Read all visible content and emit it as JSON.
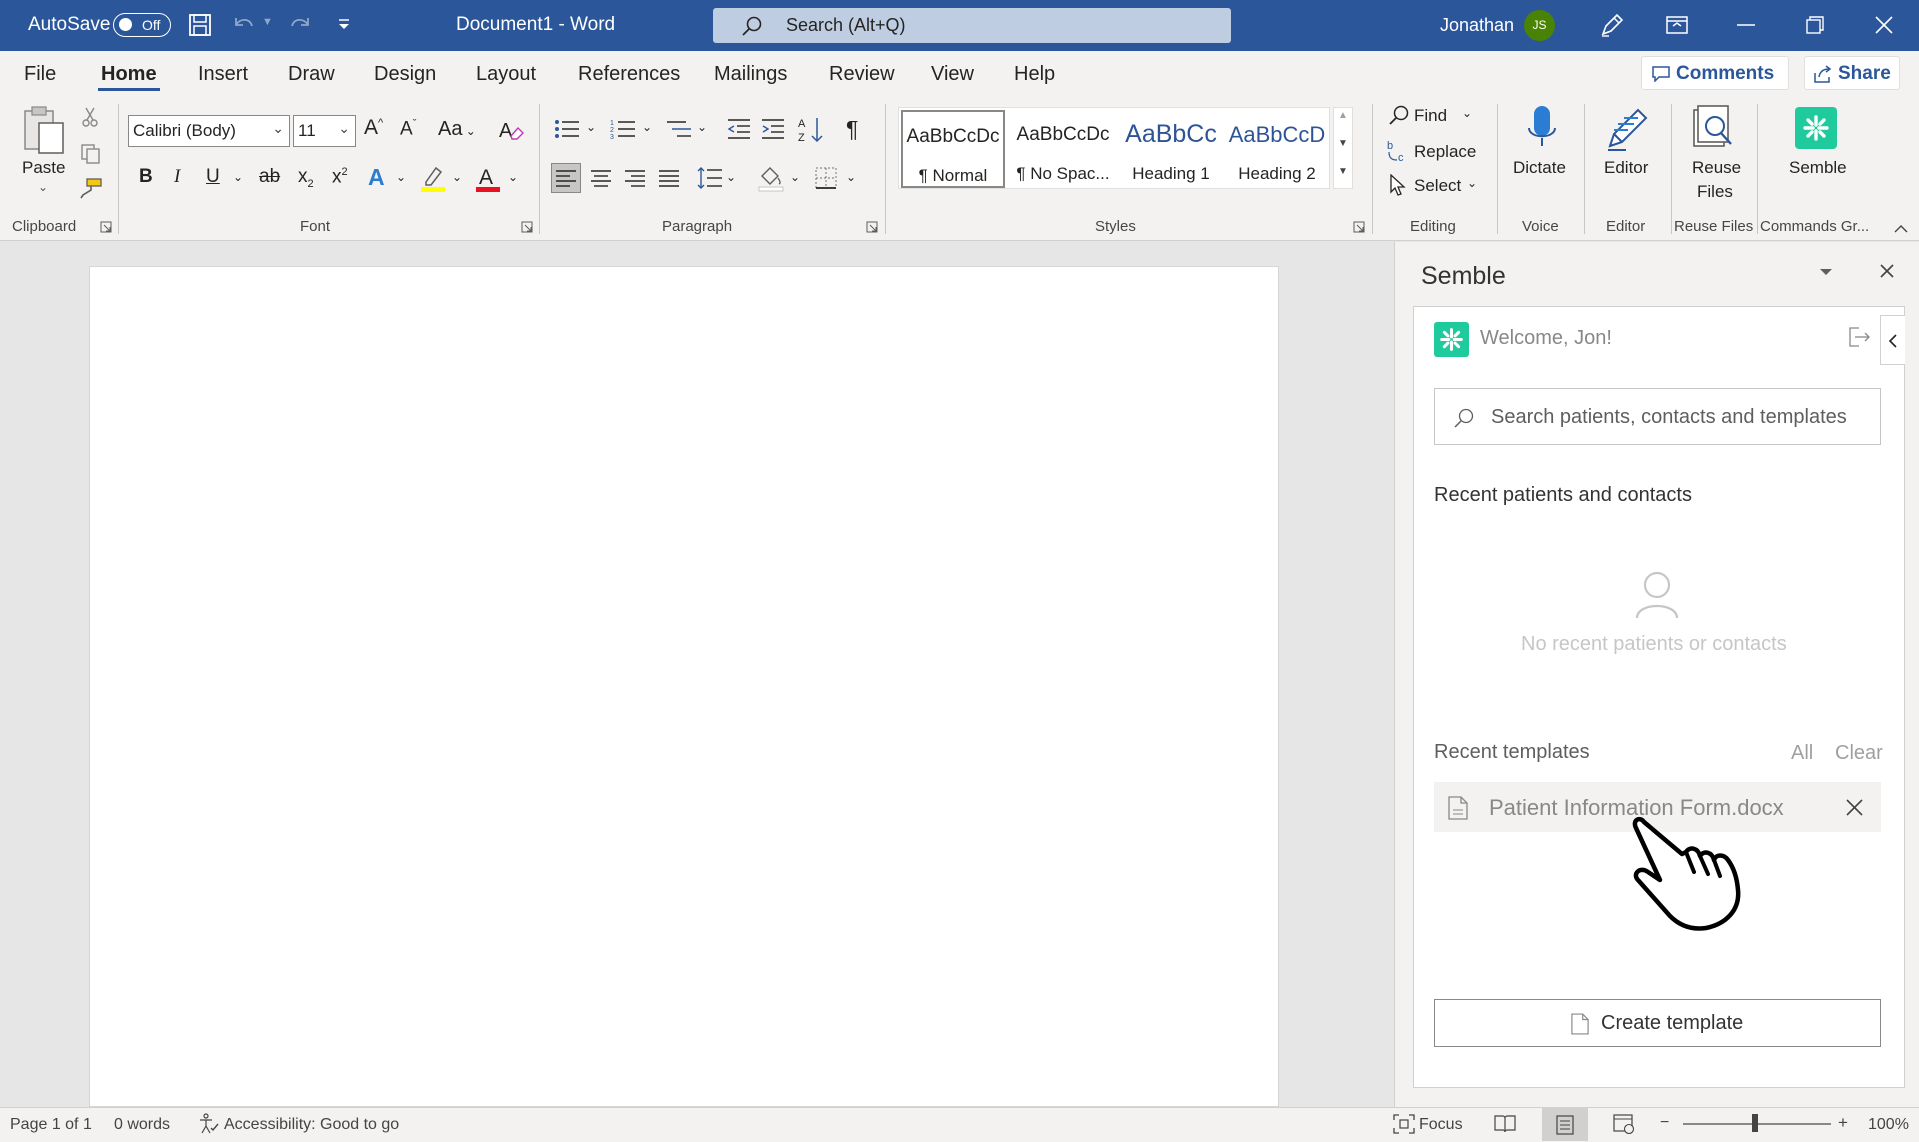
{
  "titlebar": {
    "autosave_label": "AutoSave",
    "autosave_state": "Off",
    "document_title": "Document1  -  Word",
    "search_placeholder": "Search (Alt+Q)",
    "user_name": "Jonathan",
    "user_initials": "JS"
  },
  "tabs": [
    "File",
    "Home",
    "Insert",
    "Draw",
    "Design",
    "Layout",
    "References",
    "Mailings",
    "Review",
    "View",
    "Help"
  ],
  "active_tab": "Home",
  "top_buttons": {
    "comments": "Comments",
    "share": "Share"
  },
  "ribbon": {
    "clipboard": {
      "paste": "Paste",
      "group": "Clipboard"
    },
    "font": {
      "name": "Calibri (Body)",
      "size": "11",
      "change_case": "Aa",
      "group": "Font"
    },
    "paragraph": {
      "group": "Paragraph"
    },
    "styles": {
      "group": "Styles",
      "items": [
        {
          "preview": "AaBbCcDc",
          "name": "¶ Normal"
        },
        {
          "preview": "AaBbCcDc",
          "name": "¶ No Spac..."
        },
        {
          "preview": "AaBbCc",
          "name": "Heading 1"
        },
        {
          "preview": "AaBbCcD",
          "name": "Heading 2"
        }
      ]
    },
    "editing": {
      "find": "Find",
      "replace": "Replace",
      "select": "Select",
      "group": "Editing"
    },
    "voice": {
      "dictate": "Dictate",
      "group": "Voice"
    },
    "editor": {
      "label": "Editor",
      "group": "Editor"
    },
    "reuse": {
      "label1": "Reuse",
      "label2": "Files",
      "group": "Reuse Files"
    },
    "semble": {
      "label": "Semble",
      "group": "Commands Gr..."
    }
  },
  "pane": {
    "title": "Semble",
    "welcome": "Welcome, Jon!",
    "search_placeholder": "Search patients, contacts and templates",
    "recent_contacts_heading": "Recent patients and contacts",
    "no_recent_text": "No recent patients or contacts",
    "recent_templates_heading": "Recent templates",
    "all_link": "All",
    "clear_link": "Clear",
    "templates": [
      "Patient Information Form.docx"
    ],
    "create_template": "Create template"
  },
  "statusbar": {
    "page": "Page 1 of 1",
    "words": "0 words",
    "accessibility": "Accessibility: Good to go",
    "focus": "Focus",
    "zoom": "100%"
  },
  "colors": {
    "word_blue": "#2b579a",
    "semble_green": "#1fca9c",
    "avatar_green": "#498205"
  }
}
